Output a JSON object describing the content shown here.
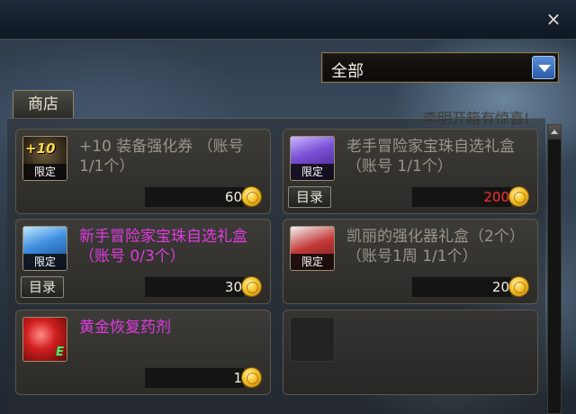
{
  "header": {
    "close_glyph": "×"
  },
  "filter": {
    "selected": "全部"
  },
  "tabs": {
    "shop": "商店"
  },
  "banner_text": "李明开箱有惊喜!",
  "items": [
    {
      "icon_text": "+10",
      "badge": "限定",
      "name": "+10 装备强化券 （账号 1/1个）",
      "price": "60",
      "has_catalog": false,
      "name_color": "#9a958a"
    },
    {
      "badge": "限定",
      "name": "老手冒险家宝珠自选礼盒 （账号 1/1个）",
      "price": "200",
      "has_catalog": true,
      "catalog_label": "目录",
      "price_color": "#ff3030"
    },
    {
      "badge": "限定",
      "name": "新手冒险家宝珠自选礼盒 （账号 0/3个）",
      "price": "30",
      "has_catalog": true,
      "catalog_label": "目录",
      "name_color": "#e13be0"
    },
    {
      "badge": "限定",
      "name": "凯丽的强化器礼盒（2个）（账号1周 1/1个）",
      "price": "20",
      "has_catalog": false
    },
    {
      "name": "黄金恢复药剂",
      "price": "1",
      "has_catalog": false,
      "name_color": "#e13be0"
    }
  ],
  "icons": {
    "coin": "gold-coin-icon",
    "close": "close-icon",
    "dropdown": "chevron-down-icon"
  }
}
